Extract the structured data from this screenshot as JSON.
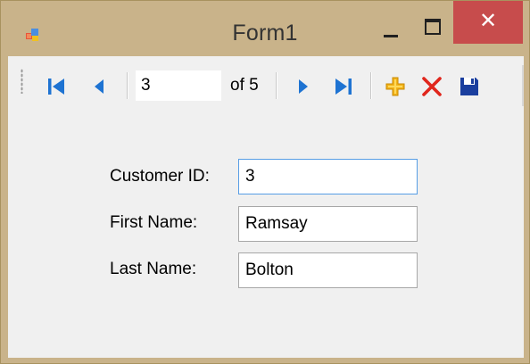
{
  "window": {
    "title": "Form1",
    "close_glyph": "✕"
  },
  "navigator": {
    "position_value": "3",
    "count_label": "of 5",
    "buttons": {
      "move_first": "move-first-icon",
      "move_previous": "move-previous-icon",
      "move_next": "move-next-icon",
      "move_last": "move-last-icon",
      "add_new": "add-new-icon",
      "delete": "delete-icon",
      "save": "save-icon"
    }
  },
  "form": {
    "customer_id_label": "Customer ID:",
    "customer_id_value": "3",
    "first_name_label": "First Name:",
    "first_name_value": "Ramsay",
    "last_name_label": "Last Name:",
    "last_name_value": "Bolton"
  },
  "colors": {
    "nav_blue": "#1e73d2",
    "add_orange": "#f2b31a",
    "delete_red": "#e0261c",
    "save_navy": "#1a3e9e",
    "close_red": "#c74c4c",
    "focus_border": "#569de5",
    "frame_tan": "#c9b38a"
  }
}
